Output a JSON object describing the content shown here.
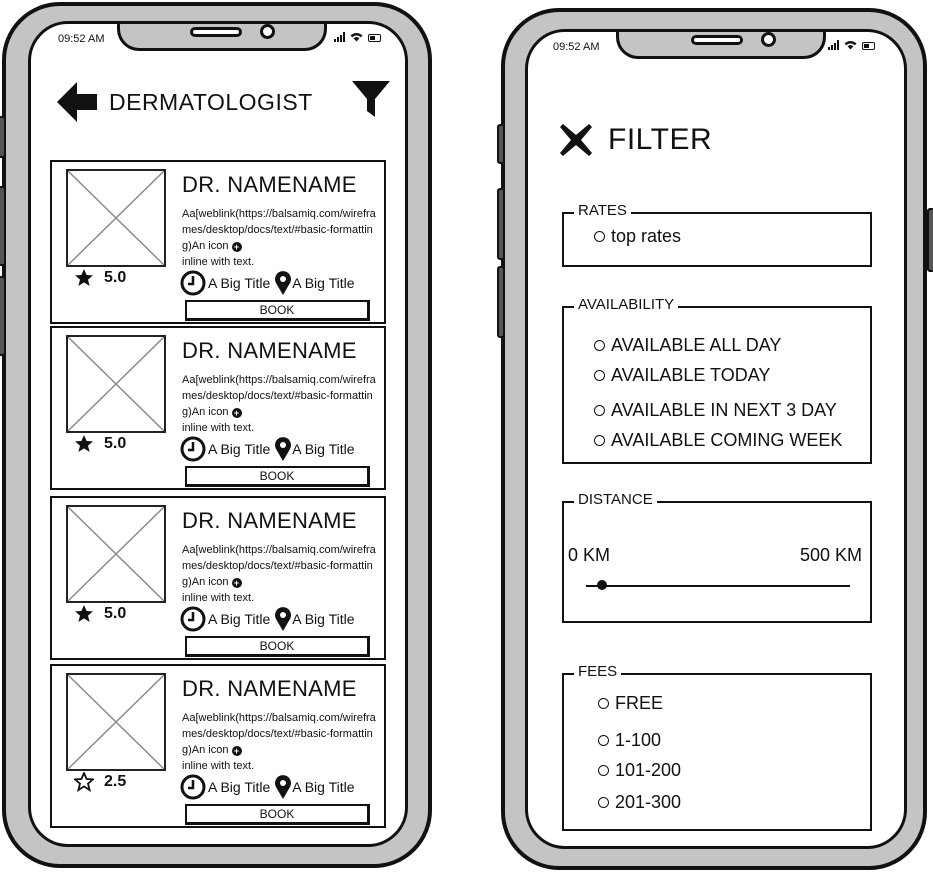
{
  "status": {
    "time": "09:52 AM"
  },
  "list_screen": {
    "title": "DERMATOLOGIST",
    "cards": [
      {
        "name": "DR. NAMENAME",
        "description": "Aa[weblink(https://balsamiq.com/wireframes/desktop/docs/text/#basic-formatting)An icon",
        "description_tail": "inline with text.",
        "rating": "5.0",
        "rating_fill": 1,
        "time_label": "A Big Title",
        "location_label": "A Big Title",
        "button": "BOOK"
      },
      {
        "name": "DR. NAMENAME",
        "description": "Aa[weblink(https://balsamiq.com/wireframes/desktop/docs/text/#basic-formatting)An icon",
        "description_tail": "inline with text.",
        "rating": "5.0",
        "rating_fill": 1,
        "time_label": "A Big Title",
        "location_label": "A Big Title",
        "button": "BOOK"
      },
      {
        "name": "DR. NAMENAME",
        "description": "Aa[weblink(https://balsamiq.com/wireframes/desktop/docs/text/#basic-formatting)An icon",
        "description_tail": "inline with text.",
        "rating": "5.0",
        "rating_fill": 1,
        "time_label": "A Big Title",
        "location_label": "A Big Title",
        "button": "BOOK"
      },
      {
        "name": "DR. NAMENAME",
        "description": "Aa[weblink(https://balsamiq.com/wireframes/desktop/docs/text/#basic-formatting)An icon",
        "description_tail": "inline with text.",
        "rating": "2.5",
        "rating_fill": 0.5,
        "time_label": "A Big Title",
        "location_label": "A Big Title",
        "button": "BOOK"
      }
    ]
  },
  "filter_screen": {
    "title": "FILTER",
    "rates": {
      "legend": "RATES",
      "options": [
        "top rates"
      ]
    },
    "availability": {
      "legend": "AVAILABILITY",
      "options": [
        "AVAILABLE ALL DAY",
        "AVAILABLE TODAY",
        "AVAILABLE IN NEXT 3 DAY",
        "AVAILABLE COMING WEEK"
      ]
    },
    "distance": {
      "legend": "DISTANCE",
      "min_label": "0 KM",
      "max_label": "500 KM",
      "value_fraction": 0.06
    },
    "fees": {
      "legend": "FEES",
      "options": [
        "FREE",
        "1-100",
        "101-200",
        "201-300"
      ]
    }
  }
}
